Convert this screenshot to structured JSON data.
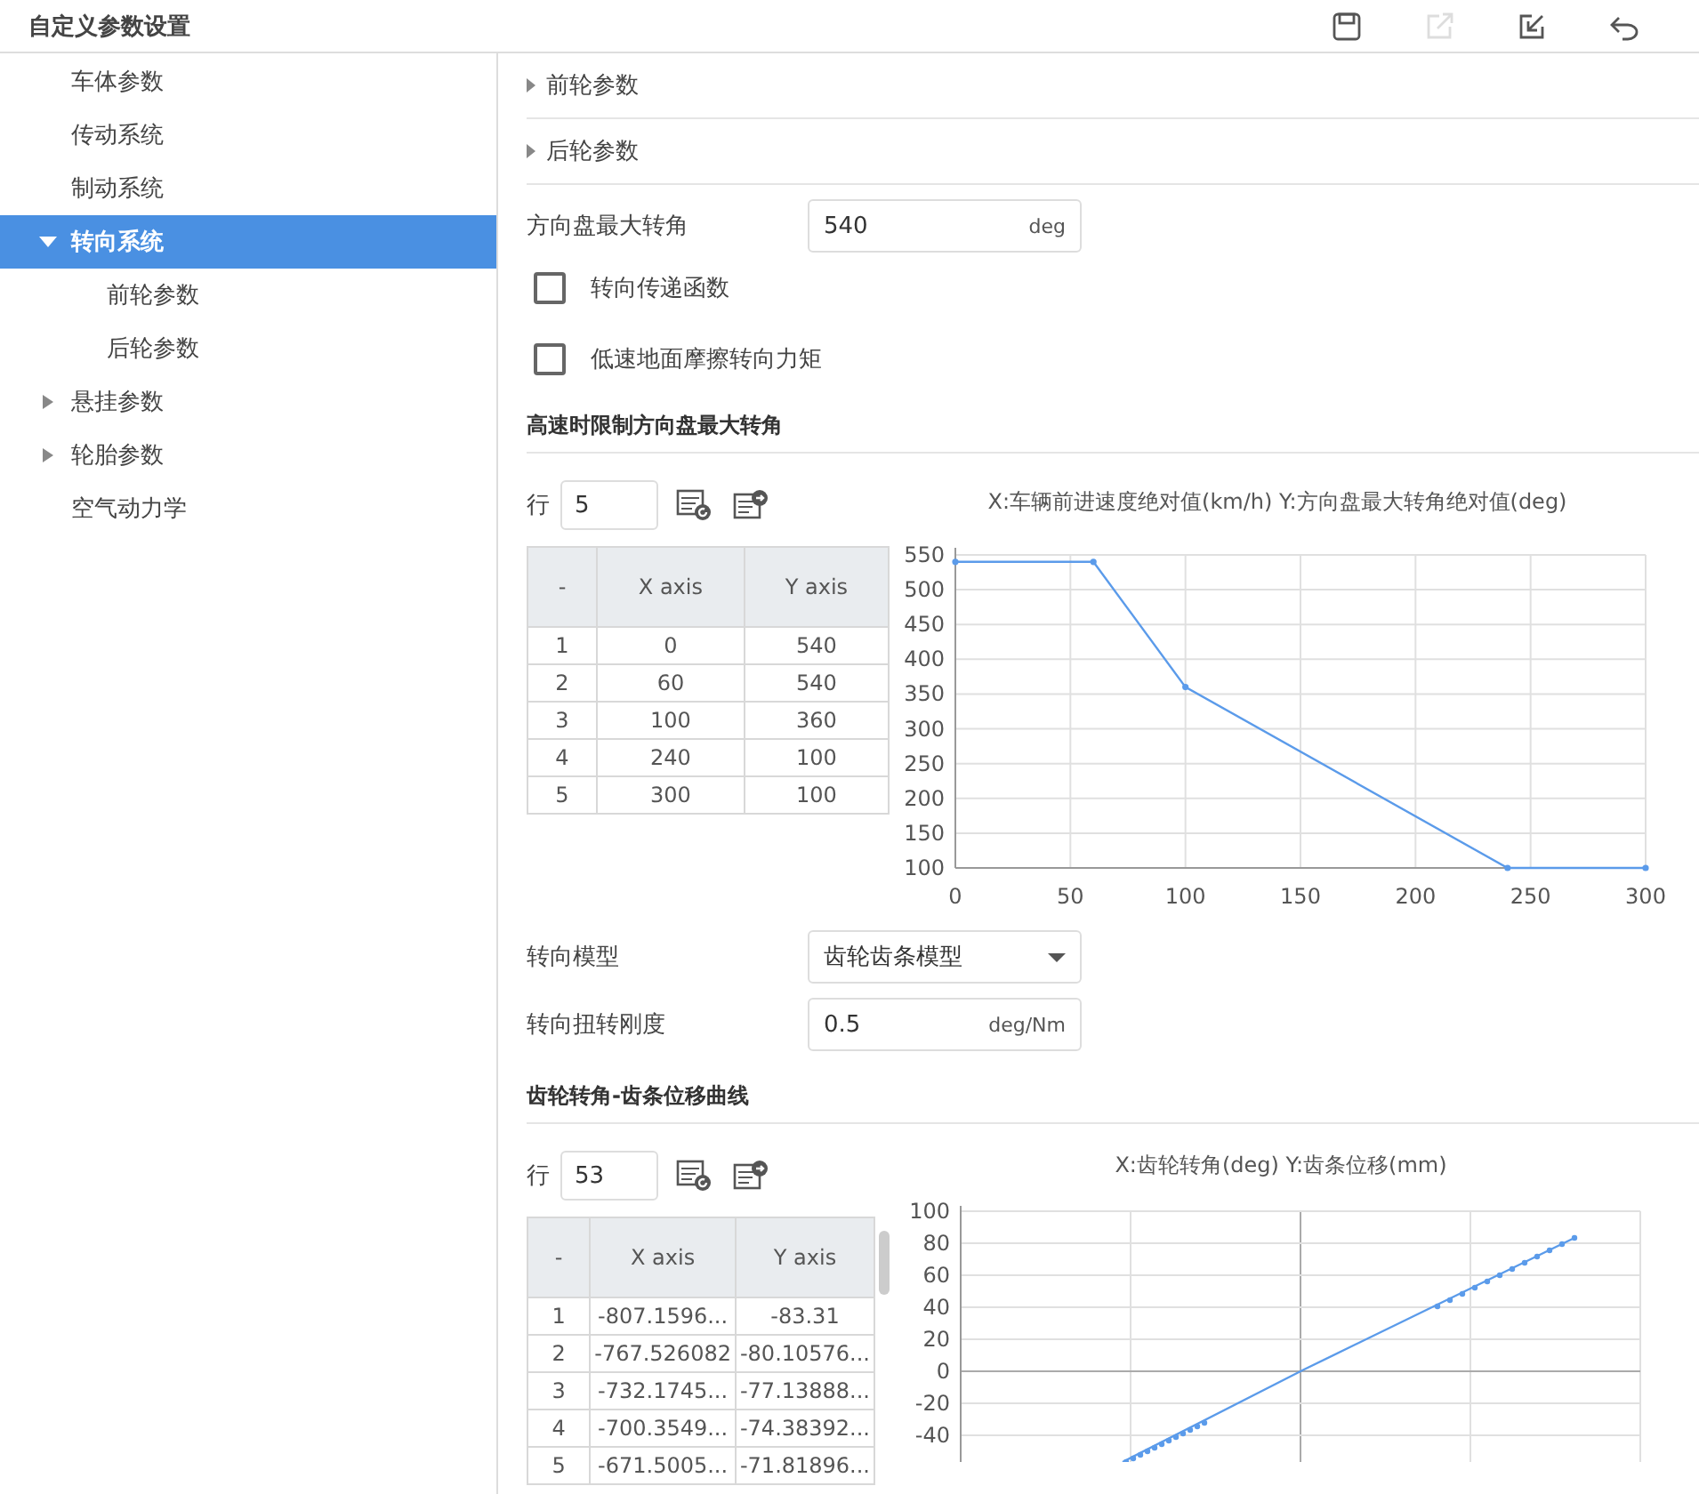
{
  "header": {
    "title": "自定义参数设置"
  },
  "toolbar": [
    {
      "kind": "save",
      "disabled": false
    },
    {
      "kind": "export",
      "disabled": true
    },
    {
      "kind": "import",
      "disabled": false
    },
    {
      "kind": "undo",
      "disabled": false
    }
  ],
  "sidebar": {
    "items": [
      {
        "label": "车体参数",
        "selected": false
      },
      {
        "label": "传动系统",
        "selected": false
      },
      {
        "label": "制动系统",
        "selected": false
      },
      {
        "label": "转向系统",
        "selected": true,
        "expanded": true,
        "children": [
          {
            "label": "前轮参数",
            "selected": false
          },
          {
            "label": "后轮参数",
            "selected": false
          }
        ]
      },
      {
        "label": "悬挂参数",
        "selected": false,
        "expanded": false
      },
      {
        "label": "轮胎参数",
        "selected": false,
        "expanded": false
      },
      {
        "label": "空气动力学",
        "selected": false
      }
    ]
  },
  "collapsibles": [
    {
      "label": "前轮参数",
      "expanded": false
    },
    {
      "label": "后轮参数",
      "expanded": false
    }
  ],
  "max_angle_field": {
    "label": "方向盘最大转角",
    "value": "540",
    "unit": "deg"
  },
  "checkboxes": [
    {
      "label": "转向传递函数",
      "checked": false
    },
    {
      "label": "低速地面摩擦转向力矩",
      "checked": false
    }
  ],
  "speed_limit_section": {
    "title": "高速时限制方向盘最大转角",
    "rows_label": "行",
    "rows_value": "5",
    "table": {
      "columns": [
        "-",
        "X axis",
        "Y axis"
      ],
      "rows": [
        [
          "1",
          "0",
          "540"
        ],
        [
          "2",
          "60",
          "540"
        ],
        [
          "3",
          "100",
          "360"
        ],
        [
          "4",
          "240",
          "100"
        ],
        [
          "5",
          "300",
          "100"
        ]
      ]
    },
    "chart_data": {
      "type": "line",
      "title": "X:车辆前进速度绝对值(km/h) Y:方向盘最大转角绝对值(deg)",
      "x": [
        0,
        60,
        100,
        240,
        300
      ],
      "grid": true,
      "series": [
        {
          "color": "#5b9bea",
          "marker": true,
          "values": [
            540,
            540,
            360,
            100,
            100
          ]
        }
      ],
      "xlim": [
        0,
        300
      ],
      "ylim": [
        100,
        550
      ],
      "xticks": [
        0,
        50,
        100,
        150,
        200,
        250,
        300
      ],
      "yticks": [
        100,
        150,
        200,
        250,
        300,
        350,
        400,
        450,
        500,
        550
      ]
    }
  },
  "model_field": {
    "label": "转向模型",
    "value": "齿轮齿条模型"
  },
  "stiffness_field": {
    "label": "转向扭转刚度",
    "value": "0.5",
    "unit": "deg/Nm"
  },
  "rack_section": {
    "title": "齿轮转角-齿条位移曲线",
    "rows_label": "行",
    "rows_value": "53",
    "table": {
      "columns": [
        "-",
        "X axis",
        "Y axis"
      ],
      "rows": [
        [
          "1",
          "-807.1596...",
          "-83.31"
        ],
        [
          "2",
          "-767.526082",
          "-80.10576..."
        ],
        [
          "3",
          "-732.1745...",
          "-77.13888..."
        ],
        [
          "4",
          "-700.3549...",
          "-74.38392..."
        ],
        [
          "5",
          "-671.5005...",
          "-71.81896..."
        ]
      ]
    },
    "chart_title": "X:齿轮转角(deg) Y:齿条位移(mm)",
    "y_tick_labels": [
      "100",
      "80",
      "60",
      "40",
      "20",
      "0",
      "-20",
      "-40"
    ]
  }
}
